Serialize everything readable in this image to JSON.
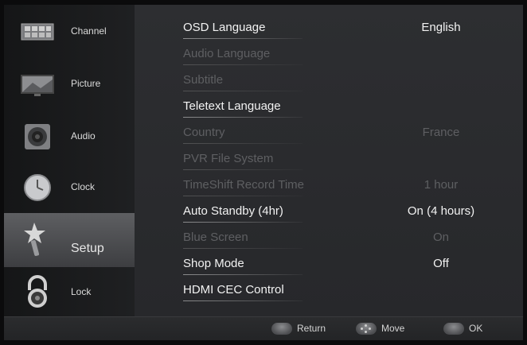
{
  "sidebar": {
    "items": [
      {
        "label": "Channel",
        "icon": "channel-icon"
      },
      {
        "label": "Picture",
        "icon": "picture-icon"
      },
      {
        "label": "Audio",
        "icon": "speaker-icon"
      },
      {
        "label": "Clock",
        "icon": "clock-icon"
      },
      {
        "label": "Setup",
        "icon": "setup-icon",
        "active": true
      },
      {
        "label": "Lock",
        "icon": "lock-icon"
      }
    ]
  },
  "menu": {
    "rows": [
      {
        "name": "OSD Language",
        "value": "English",
        "enabled": true
      },
      {
        "name": "Audio Language",
        "value": "",
        "enabled": false
      },
      {
        "name": "Subtitle",
        "value": "",
        "enabled": false
      },
      {
        "name": "Teletext Language",
        "value": "",
        "enabled": true
      },
      {
        "name": "Country",
        "value": "France",
        "enabled": false
      },
      {
        "name": "PVR File System",
        "value": "",
        "enabled": false
      },
      {
        "name": "TimeShift Record Time",
        "value": "1 hour",
        "enabled": false
      },
      {
        "name": "Auto Standby (4hr)",
        "value": "On (4 hours)",
        "enabled": true
      },
      {
        "name": "Blue Screen",
        "value": "On",
        "enabled": false
      },
      {
        "name": "Shop Mode",
        "value": "Off",
        "enabled": true
      },
      {
        "name": "HDMI CEC Control",
        "value": "",
        "enabled": true
      }
    ]
  },
  "footer": {
    "return_label": "Return",
    "move_label": "Move",
    "ok_label": "OK"
  },
  "colors": {
    "enabled_text": "#f2f2f2",
    "disabled_text": "#5e5f62",
    "active_tab": "#55565a"
  }
}
